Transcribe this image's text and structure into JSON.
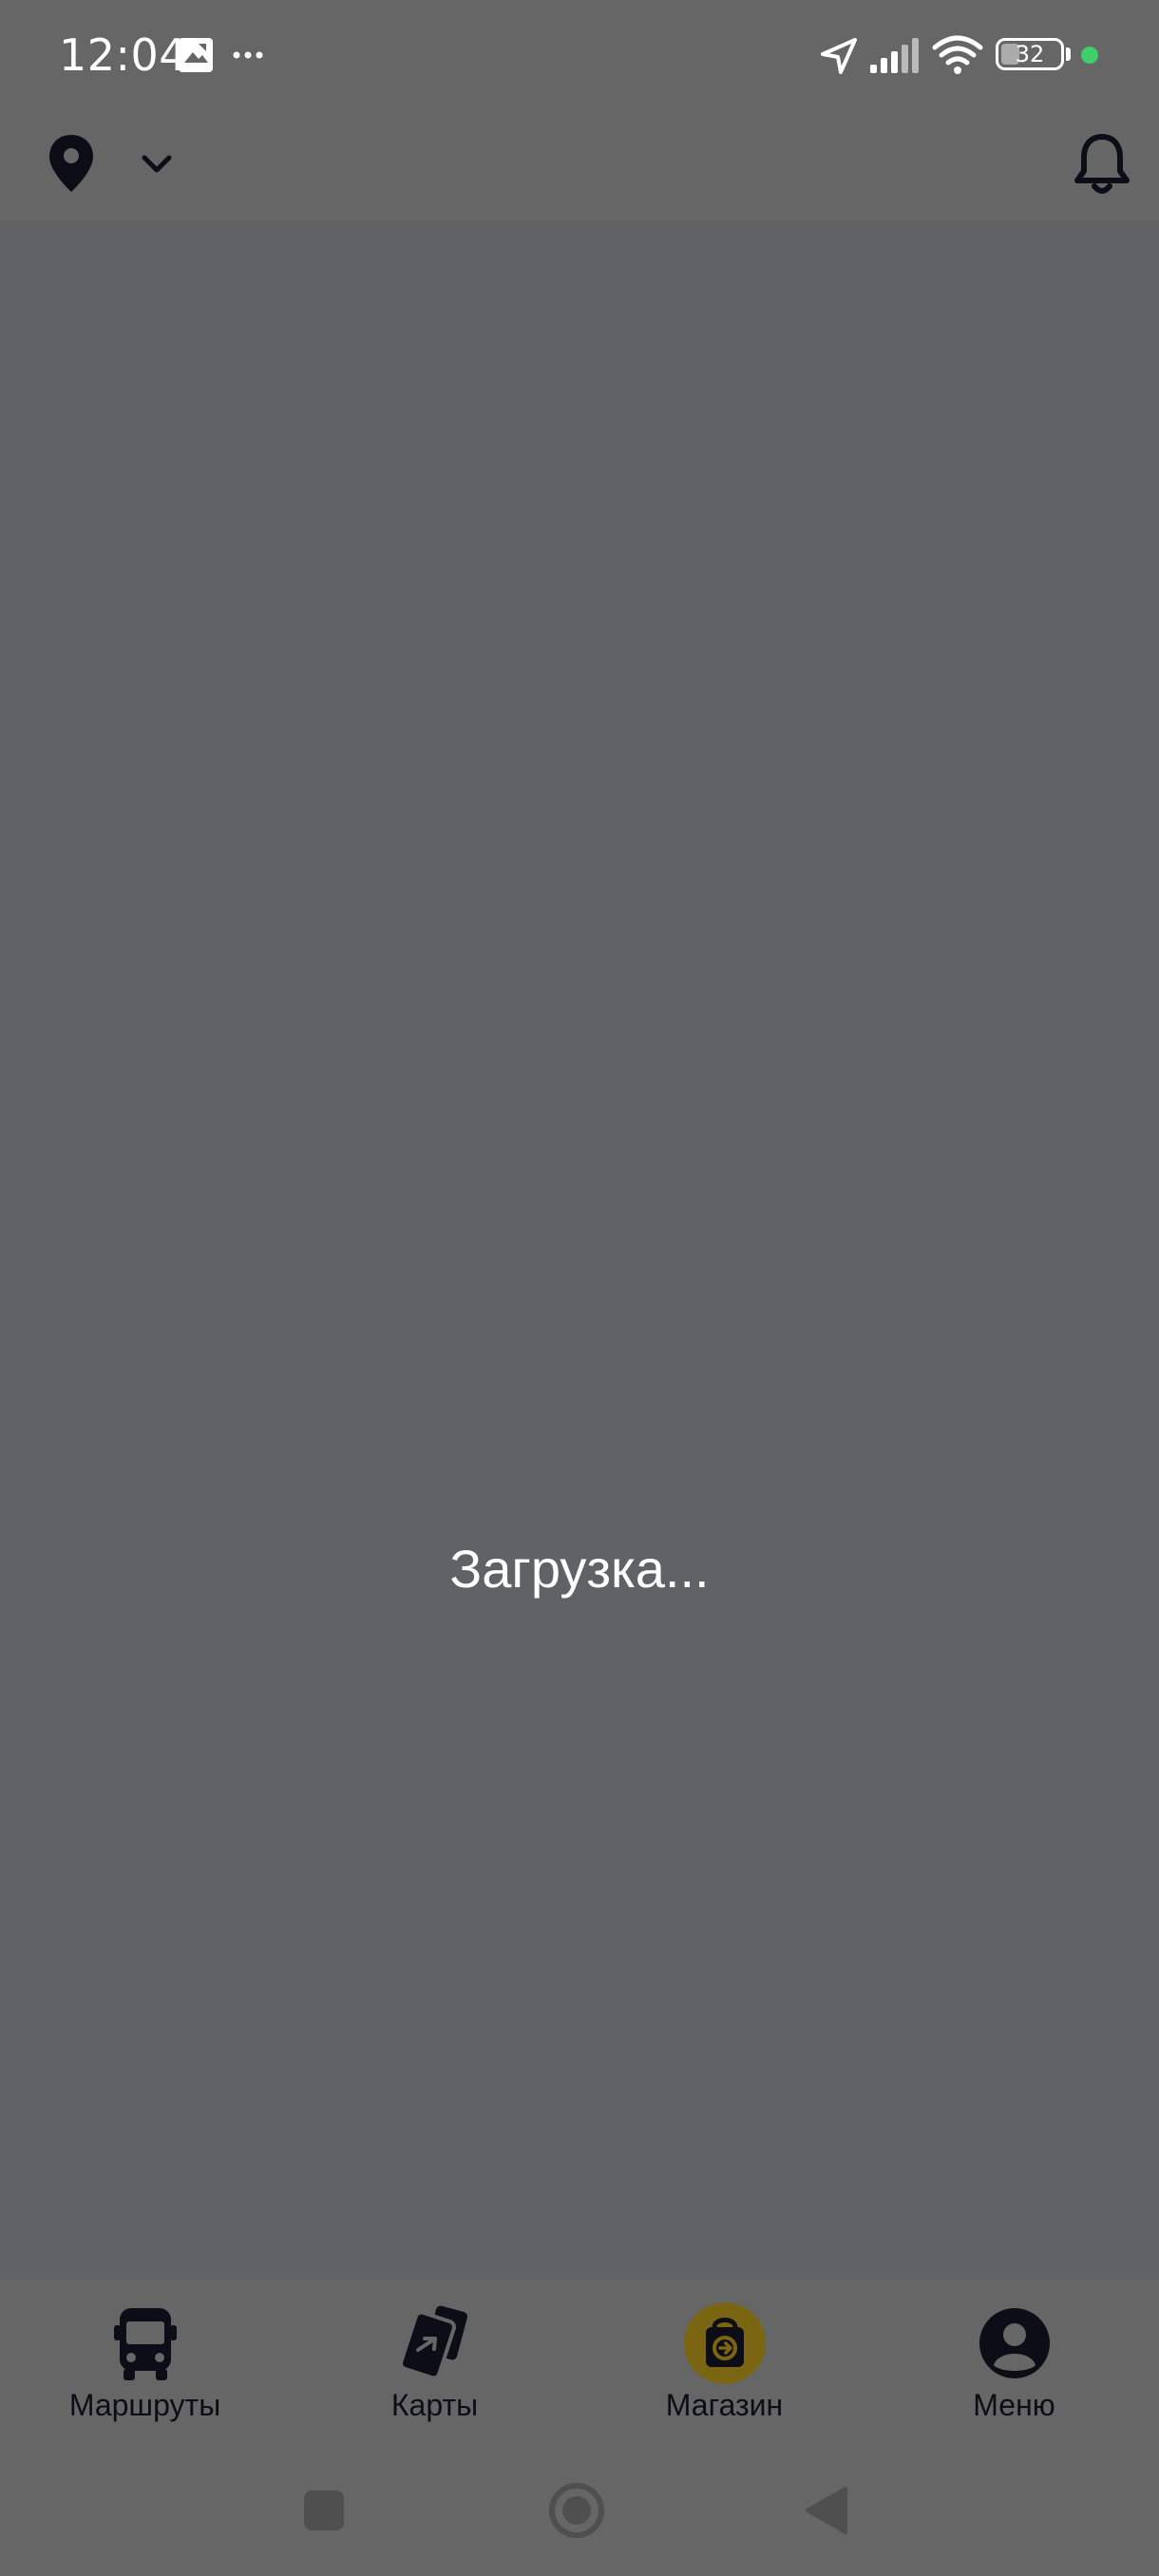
{
  "status_bar": {
    "time": "12:04",
    "battery_level": "32",
    "battery_fraction": 0.32,
    "icons": [
      "gallery-notification-icon",
      "more-notifications-icon",
      "location-arrow-icon",
      "signal-icon",
      "wifi-icon",
      "battery-icon"
    ],
    "privacy_dot_color": "#3ccf6b"
  },
  "header": {
    "icons": [
      "location-pin-icon",
      "chevron-down-icon",
      "bell-icon"
    ],
    "icon_color": "#0d0d18"
  },
  "content": {
    "loading_text": "Загрузка..."
  },
  "bottom_nav": {
    "items": [
      {
        "label": "Маршруты",
        "icon": "bus-icon"
      },
      {
        "label": "Карты",
        "icon": "cards-icon"
      },
      {
        "label": "Магазин",
        "icon": "shopping-bag-icon",
        "active": true
      },
      {
        "label": "Меню",
        "icon": "user-icon"
      }
    ],
    "active_color": "#7a6612"
  },
  "system_nav": {
    "buttons": [
      "recents-button",
      "home-button",
      "back-button"
    ]
  }
}
